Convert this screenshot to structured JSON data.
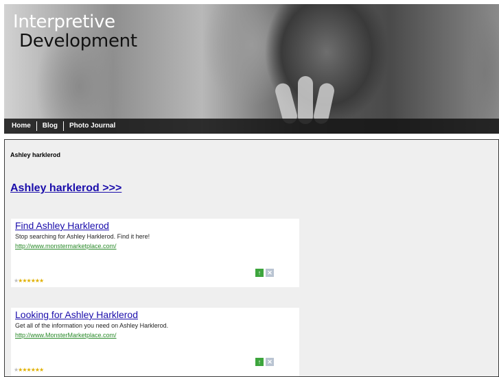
{
  "header": {
    "title_line1": "Interpretive",
    "title_line2": "Development"
  },
  "nav": [
    {
      "label": "Home"
    },
    {
      "label": "Blog"
    },
    {
      "label": "Photo Journal"
    }
  ],
  "main": {
    "heading": "Ashley harklerod",
    "link_text": "Ashley harklerod >>>"
  },
  "ads": [
    {
      "title": "Find Ashley Harklerod",
      "description": "Stop searching for Ashley Harklerod. Find it here!",
      "url": "http://www.monstermarketplace.com/",
      "rating": "6 of 7",
      "up_icon": "arrow-up-icon",
      "close_icon": "close-icon"
    },
    {
      "title": "Looking for Ashley Harklerod",
      "description": "Get all of the information you need on Ashley Harklerod.",
      "url": "http://www.MonsterMarketplace.com/",
      "rating": "6 of 7",
      "up_icon": "arrow-up-icon",
      "close_icon": "close-icon"
    }
  ],
  "colors": {
    "link": "#1a0dab",
    "url": "#2a8a2a",
    "star": "#e0b000",
    "panel_bg": "#efefef"
  }
}
